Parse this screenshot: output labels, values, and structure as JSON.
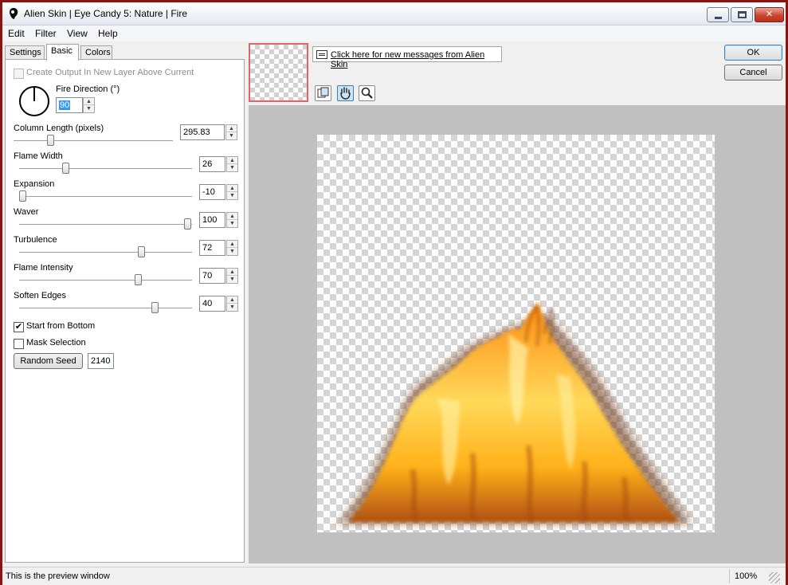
{
  "window": {
    "title": "Alien Skin | Eye Candy 5: Nature | Fire",
    "minimize_glyph": "",
    "maximize_glyph": "",
    "close_glyph": "✕"
  },
  "menu": [
    "Edit",
    "Filter",
    "View",
    "Help"
  ],
  "tabs": [
    {
      "label": "Settings",
      "active": false
    },
    {
      "label": "Basic",
      "active": true
    },
    {
      "label": "Colors",
      "active": false
    }
  ],
  "basic": {
    "create_output_label": "Create Output In New Layer Above Current",
    "create_output_checked": false,
    "fire_direction_label": "Fire Direction (°)",
    "fire_direction_value": "90",
    "sliders": [
      {
        "label": "Column Length (pixels)",
        "value": "295.83",
        "fraction": 0.22
      },
      {
        "label": "Flame Width",
        "value": "26",
        "fraction": 0.26
      },
      {
        "label": "Expansion",
        "value": "-10",
        "fraction": 0.0
      },
      {
        "label": "Waver",
        "value": "100",
        "fraction": 1.0
      },
      {
        "label": "Turbulence",
        "value": "72",
        "fraction": 0.72
      },
      {
        "label": "Flame Intensity",
        "value": "70",
        "fraction": 0.7
      },
      {
        "label": "Soften Edges",
        "value": "40",
        "fraction": 0.8
      }
    ],
    "start_from_bottom_label": "Start from Bottom",
    "start_from_bottom_checked": true,
    "mask_selection_label": "Mask Selection",
    "mask_selection_checked": false,
    "random_seed_label": "Random Seed",
    "random_seed_value": "2140"
  },
  "messages_link": "Click here for new messages from Alien Skin",
  "tools": [
    {
      "name": "preview-compare-icon",
      "active": false
    },
    {
      "name": "hand-icon",
      "active": true
    },
    {
      "name": "magnifier-icon",
      "active": false
    }
  ],
  "buttons": {
    "ok": "OK",
    "cancel": "Cancel"
  },
  "status": {
    "text": "This is the preview window",
    "zoom": "100%"
  },
  "colors": {
    "frame": "#8d1212",
    "preview_bg": "#c0c0c0",
    "thumb_border": "#e06666"
  }
}
